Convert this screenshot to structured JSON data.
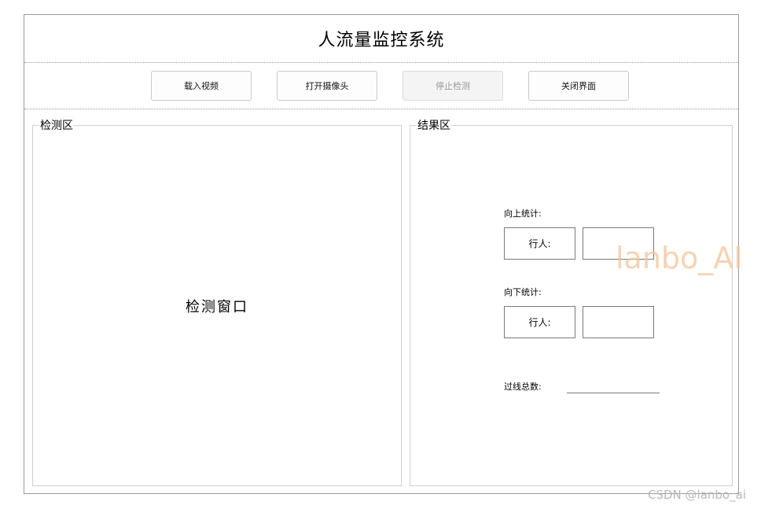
{
  "window": {
    "title": "人流量监控系统"
  },
  "toolbar": {
    "load_video": "载入视频",
    "open_camera": "打开摄像头",
    "stop_detect": "停止检测",
    "close_ui": "关闭界面"
  },
  "detection": {
    "group_title": "检测区",
    "window_label": "检测窗口"
  },
  "results": {
    "group_title": "结果区",
    "up_label": "向上统计:",
    "up_pedestrian_label": "行人:",
    "up_pedestrian_value": "",
    "down_label": "向下统计:",
    "down_pedestrian_label": "行人:",
    "down_pedestrian_value": "",
    "total_label": "过线总数:",
    "total_value": ""
  },
  "watermarks": {
    "overlay": "lanbo_AI",
    "footer": "CSDN @lanbo_ai"
  }
}
